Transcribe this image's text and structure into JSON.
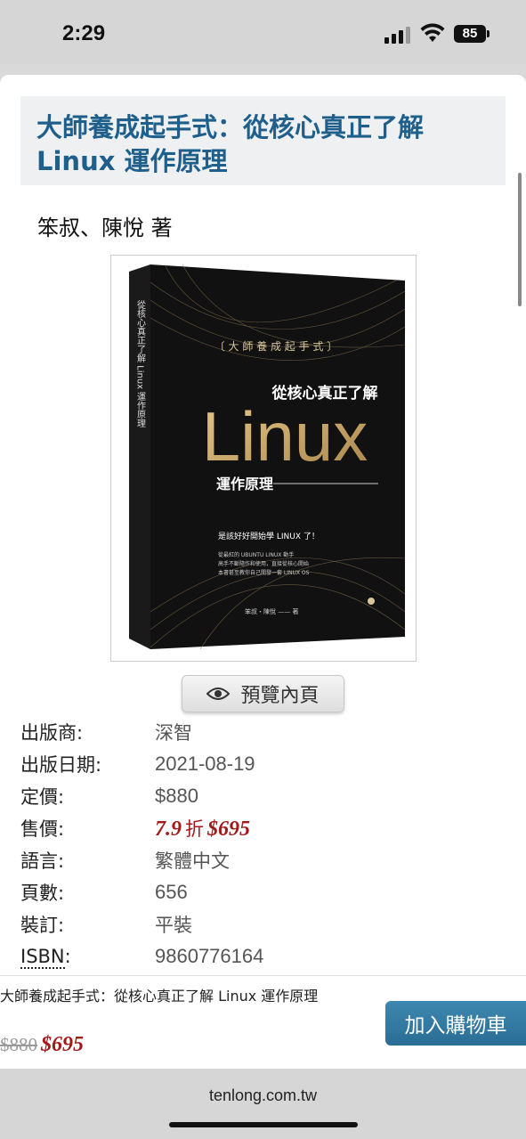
{
  "status": {
    "time": "2:29",
    "battery": "85"
  },
  "book": {
    "title": "大師養成起手式：從核心真正了解 Linux 運作原理",
    "author_line": "笨叔、陳悅 著",
    "cover": {
      "series": "〔 大 師 養 成 起 手 式 〕",
      "subtitle": "從核心真正了解",
      "big_title": "Linux",
      "tagline": "運作原理",
      "spine_text": "從核心真正了解 Linux 運作原理",
      "blurb_head": "是該好好開始學 LINUX 了！",
      "blurb_1": "從最紅的 UBUNTU LINUX 動手",
      "blurb_2": "高手不斷隨作和使用，直接從核心開始",
      "blurb_3": "本書甚至教你自己開發一套 LINUX OS",
      "cover_author": "笨叔・陳悅 —— 著"
    },
    "preview_label": "預覽內頁"
  },
  "details": {
    "publisher_label": "出版商:",
    "publisher": "深智",
    "date_label": "出版日期:",
    "date": "2021-08-19",
    "list_price_label": "定價:",
    "list_price": "$880",
    "sale_label": "售價:",
    "discount": "7.9",
    "discount_unit": "折",
    "sale_price": "$695",
    "language_label": "語言:",
    "language": "繁體中文",
    "pages_label": "頁數:",
    "pages": "656",
    "binding_label": "裝訂:",
    "binding": "平裝",
    "isbn_label": "ISBN",
    "isbn_colon": ":",
    "isbn": "9860776164"
  },
  "buy_bar": {
    "title": "大師養成起手式：從核心真正了解 Linux 運作原理",
    "old_price": "$880",
    "new_price": "$695",
    "cart_label": "加入購物車"
  },
  "browser": {
    "url": "tenlong.com.tw"
  },
  "colors": {
    "accent": "#1f5f8b",
    "sale": "#a01a1a",
    "cart_button": "#2f789f"
  }
}
